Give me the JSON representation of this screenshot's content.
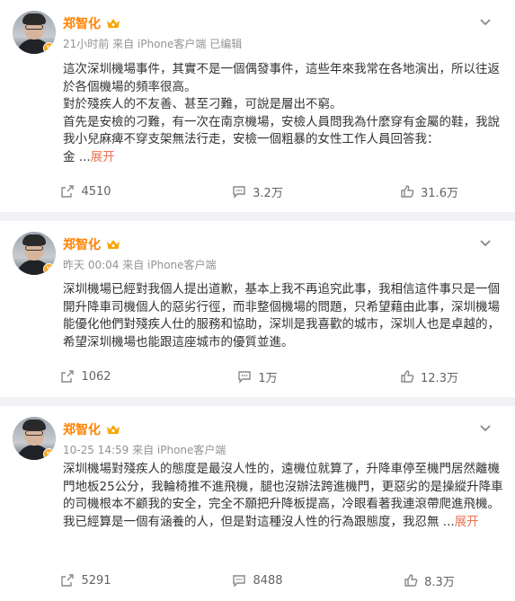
{
  "posts": [
    {
      "author": "郑智化",
      "meta": "21小时前 来自 iPhone客户端 已编辑",
      "paragraphs": [
        "這次深圳機場事件，其實不是一個偶發事件，這些年來我常在各地演出，所以往返於各個機場的頻率很高。",
        "對於殘疾人的不友善、甚至刁難，可說是層出不窮。",
        "首先是安檢的刁難，有一次在南京機場，安檢人員問我為什麼穿有金屬的鞋，我說我小兒麻痺不穿支架無法行走，安檢一個粗暴的女性工作人員回答我：",
        "金 ..."
      ],
      "expand_label": "展开",
      "repost": "4510",
      "comment": "3.2万",
      "like": "31.6万"
    },
    {
      "author": "郑智化",
      "meta": "昨天 00:04 来自 iPhone客户端",
      "paragraphs": [
        "深圳機場已經對我個人提出道歉，基本上我不再追究此事，我相信這件事只是一個開升降車司機個人的惡劣行徑，而非整個機場的問題，只希望藉由此事，深圳機場能優化他們對殘疾人仕的服務和協助，深圳是我喜歡的城市，深圳人也是卓越的，希望深圳機場也能跟這座城市的優質並進。"
      ],
      "expand_label": "",
      "repost": "1062",
      "comment": "1万",
      "like": "12.3万"
    },
    {
      "author": "郑智化",
      "meta": "10-25 14:59 来自 iPhone客户端",
      "paragraphs": [
        "深圳機場對殘疾人的態度是最沒人性的，遠機位就算了，升降車停至機門居然離機門地板25公分，我輪椅推不進飛機，腿也沒辦法跨進機門，更惡劣的是操縱升降車的司機根本不顧我的安全，完全不願把升降板提高，冷眼看著我連滾帶爬進飛機。",
        "我已經算是一個有涵養的人，但是對這種沒人性的行為跟態度，我忍無 ..."
      ],
      "expand_label": "展开",
      "repost": "5291",
      "comment": "8488",
      "like": "8.3万"
    }
  ],
  "colors": {
    "name": "#ff8200",
    "expand": "#eb7350",
    "meta": "#939393"
  },
  "icons": {
    "badge": "verified-v-icon",
    "crown": "crown-icon",
    "repost": "repost-icon",
    "comment": "comment-icon",
    "like": "like-icon",
    "menu": "chevron-down-icon"
  }
}
